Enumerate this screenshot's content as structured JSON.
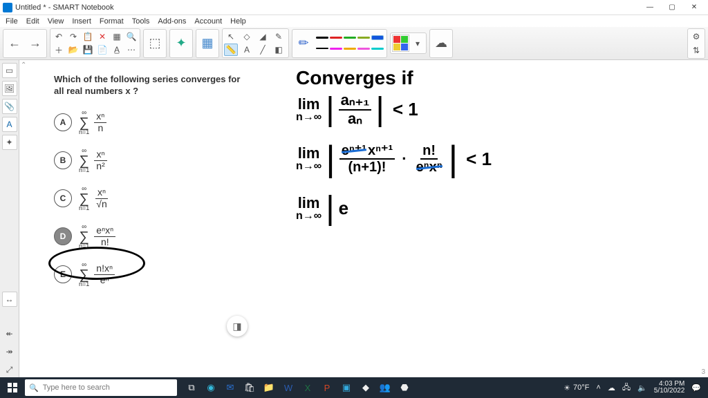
{
  "title": "Untitled * - SMART Notebook",
  "menu": [
    "File",
    "Edit",
    "View",
    "Insert",
    "Format",
    "Tools",
    "Add-ons",
    "Account",
    "Help"
  ],
  "question": {
    "stem": "Which of the following series converges for all real numbers x ?",
    "options": {
      "A": {
        "sum_top": "∞",
        "sum_bot": "n=1",
        "num": "xⁿ",
        "den": "n"
      },
      "B": {
        "sum_top": "∞",
        "sum_bot": "n=1",
        "num": "xⁿ",
        "den": "n²"
      },
      "C": {
        "sum_top": "∞",
        "sum_bot": "n=1",
        "num": "xⁿ",
        "den": "√n"
      },
      "D": {
        "sum_top": "∞",
        "sum_bot": "n=1",
        "num": "eⁿxⁿ",
        "den": "n!"
      },
      "E": {
        "sum_top": "∞",
        "sum_bot": "n=1",
        "num": "n!xⁿ",
        "den": "eⁿ"
      }
    },
    "selected": "D"
  },
  "handwriting": {
    "line1": "Converges if",
    "lim": "lim",
    "ntoinf": "n→∞",
    "ratio_num": "aₙ₊₁",
    "ratio_den": "aₙ",
    "lt1": "< 1",
    "expr_en1": "eⁿ⁺¹",
    "expr_xn1": "xⁿ⁺¹",
    "expr_den1": "(n+1)!",
    "dot": "·",
    "expr_nfact": "n!",
    "expr_enxn": "eⁿxⁿ",
    "line3_tail": "e"
  },
  "eraser_icon": "eraser",
  "page_number": "3",
  "taskbar": {
    "search_placeholder": "Type here to search",
    "weather_temp": "70°F",
    "time": "4:03 PM",
    "date": "5/10/2022"
  }
}
